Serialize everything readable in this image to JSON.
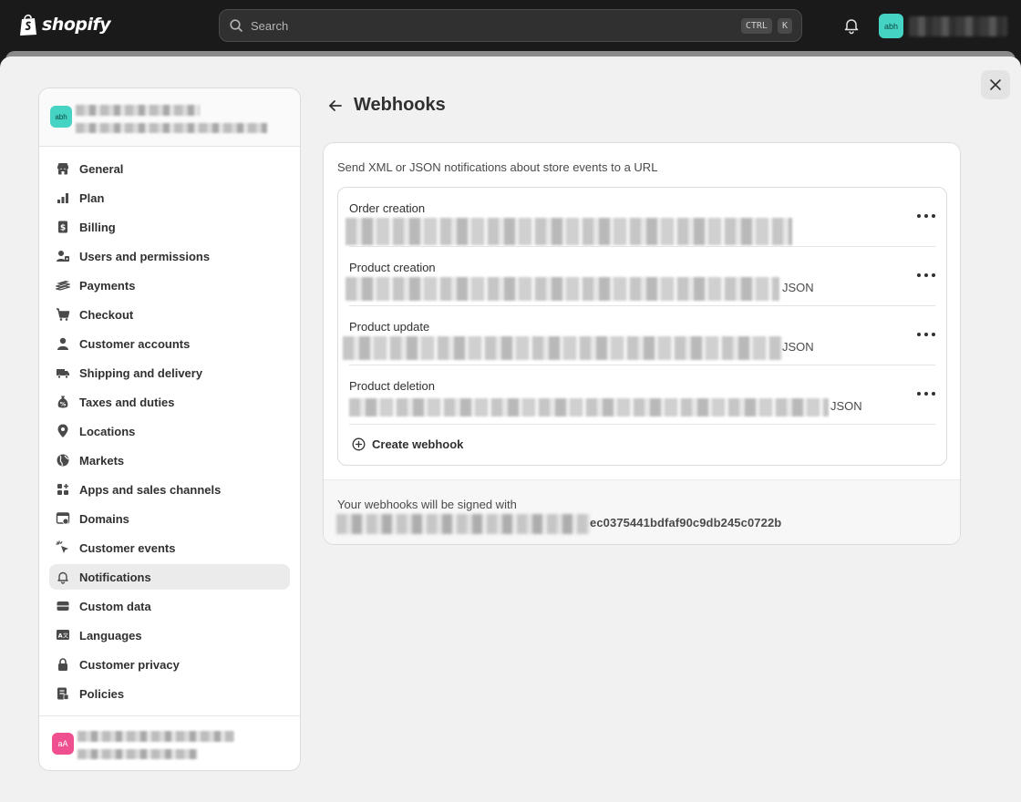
{
  "topbar": {
    "logo_text": "shopify",
    "search": {
      "placeholder": "Search",
      "shortcut_keys": [
        "CTRL",
        "K"
      ]
    },
    "user_avatar_initials": "abh"
  },
  "sidebar": {
    "store_avatar_initials": "abh",
    "items": [
      {
        "label": "General",
        "icon": "store-icon"
      },
      {
        "label": "Plan",
        "icon": "plan-icon"
      },
      {
        "label": "Billing",
        "icon": "billing-icon"
      },
      {
        "label": "Users and permissions",
        "icon": "users-icon"
      },
      {
        "label": "Payments",
        "icon": "payments-icon"
      },
      {
        "label": "Checkout",
        "icon": "cart-icon"
      },
      {
        "label": "Customer accounts",
        "icon": "person-icon"
      },
      {
        "label": "Shipping and delivery",
        "icon": "truck-icon"
      },
      {
        "label": "Taxes and duties",
        "icon": "tax-icon"
      },
      {
        "label": "Locations",
        "icon": "location-icon"
      },
      {
        "label": "Markets",
        "icon": "globe-icon"
      },
      {
        "label": "Apps and sales channels",
        "icon": "apps-icon"
      },
      {
        "label": "Domains",
        "icon": "domain-icon"
      },
      {
        "label": "Customer events",
        "icon": "cursor-icon"
      },
      {
        "label": "Notifications",
        "icon": "bell-icon",
        "active": true
      },
      {
        "label": "Custom data",
        "icon": "database-icon"
      },
      {
        "label": "Languages",
        "icon": "language-icon"
      },
      {
        "label": "Customer privacy",
        "icon": "lock-icon"
      },
      {
        "label": "Policies",
        "icon": "policy-icon"
      }
    ],
    "footer_avatar_initials": "aA"
  },
  "page": {
    "title": "Webhooks",
    "description": "Send XML or JSON notifications about store events to a URL",
    "webhooks": [
      {
        "event": "Order creation",
        "format": ""
      },
      {
        "event": "Product creation",
        "format": "JSON"
      },
      {
        "event": "Product update",
        "format": "JSON"
      },
      {
        "event": "Product deletion",
        "format": "JSON"
      }
    ],
    "create_label": "Create webhook",
    "signed_label": "Your webhooks will be signed with",
    "secret_visible_tail": "ec0375441bdfaf90c9db245c0722b"
  }
}
